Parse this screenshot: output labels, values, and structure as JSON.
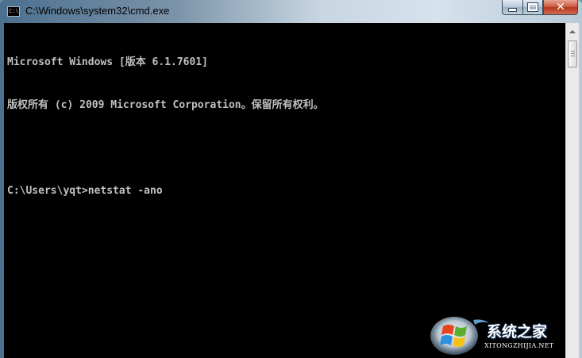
{
  "window": {
    "title": "C:\\Windows\\system32\\cmd.exe",
    "icon_label": "C:\\"
  },
  "console": {
    "lines": [
      "Microsoft Windows [版本 6.1.7601]",
      "版权所有 (c) 2009 Microsoft Corporation。保留所有权利。",
      "",
      "C:\\Users\\yqt>netstat -ano"
    ],
    "text_color": "#c0c0c0",
    "background": "#000000"
  },
  "controls": {
    "close_symbol": "✕"
  },
  "watermark": {
    "brand": "系统之家",
    "site": "XITONGZHIJIA.NET",
    "logo_icon": "windows-flag-logo"
  }
}
